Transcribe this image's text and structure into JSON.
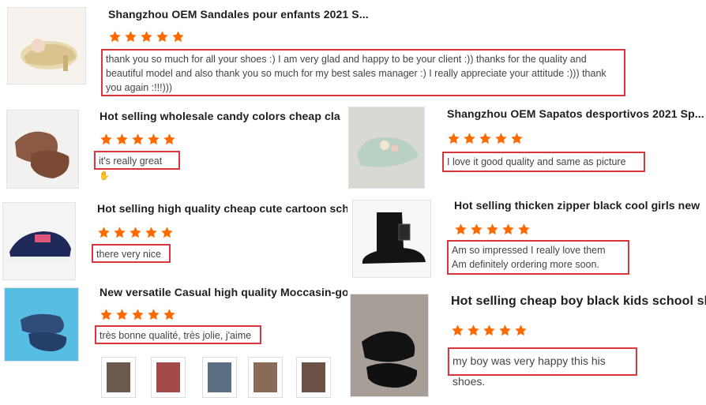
{
  "products": [
    {
      "title": "Shangzhou OEM Sandales pour enfants 2021 S...",
      "review": "thank you so much for all your shoes :) I am very glad and happy to be your client :)) thanks for the quality and beautiful model and also thank you so much for my best sales manager :) I really appreciate your attitude :))) thank you again :!!!)))",
      "rating": 5,
      "image": "gold-sandal-image"
    },
    {
      "title": "Hot selling wholesale candy colors cheap clas...",
      "review": "it's really great",
      "review_icon": "thumbs-up-icon",
      "rating": 5,
      "image": "brown-loafer-image"
    },
    {
      "title": "Shangzhou OEM Sapatos desportivos 2021 Sp...",
      "review": "I love it good quality and same as picture",
      "rating": 5,
      "image": "green-sneaker-image"
    },
    {
      "title": "Hot selling high quality cheap cute cartoon sch...",
      "review": "there very nice",
      "rating": 5,
      "image": "navy-cartoon-sneaker-image"
    },
    {
      "title": "Hot selling thicken zipper black cool girls new",
      "review_lines": [
        "Am so impressed I really love them",
        "Am definitely ordering more soon."
      ],
      "rating": 5,
      "image": "black-boot-image"
    },
    {
      "title": "New versatile Casual high quality Moccasin-go.",
      "review": "très bonne qualité, très jolie, j'aime",
      "rating": 5,
      "image": "denim-moccasin-image",
      "thumbnails": [
        "thumb-1",
        "thumb-2",
        "thumb-3",
        "thumb-4",
        "thumb-5"
      ]
    },
    {
      "title": "Hot selling cheap boy black kids school shoes",
      "review": "my boy was very happy this his shoes.",
      "rating": 5,
      "image": "black-school-shoe-image"
    }
  ],
  "colors": {
    "star": "#ff6a00",
    "highlight": "#d9363e"
  }
}
